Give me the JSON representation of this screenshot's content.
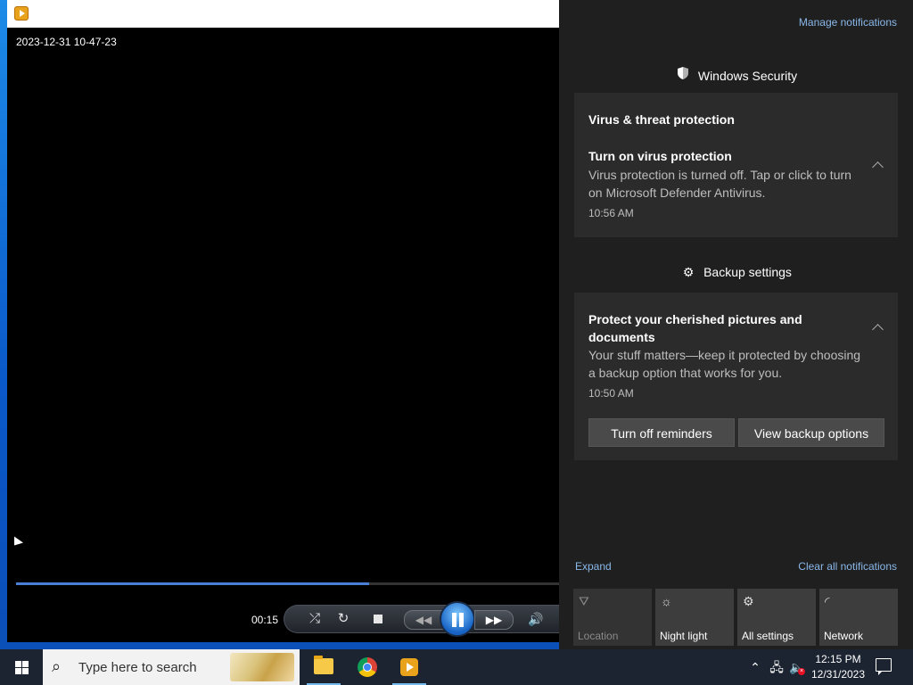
{
  "player": {
    "video_timestamp": "2023-12-31 10-47-23",
    "elapsed": "00:15",
    "progress_fraction": 0.65,
    "controls": {
      "shuffle_icon": "shuffle-icon",
      "repeat_icon": "repeat-icon",
      "stop_icon": "stop-icon",
      "prev_icon": "previous-icon",
      "play_state": "pause-icon",
      "next_icon": "next-icon",
      "volume_icon": "volume-icon"
    }
  },
  "action_center": {
    "manage_label": "Manage notifications",
    "groups": [
      {
        "app": "Windows Security",
        "icon": "shield-icon",
        "card": {
          "title": "Virus & threat protection",
          "heading": "Turn on virus protection",
          "body": "Virus protection is turned off. Tap or click to turn on Microsoft Defender Antivirus.",
          "time": "10:56 AM"
        }
      },
      {
        "app": "Backup settings",
        "icon": "gear-icon",
        "card": {
          "heading": "Protect your cherished pictures and documents",
          "body": "Your stuff matters—keep it protected by choosing a backup option that works for you.",
          "time": "10:50 AM",
          "buttons": [
            "Turn off reminders",
            "View backup options"
          ]
        }
      }
    ],
    "expand_label": "Expand",
    "clear_label": "Clear all notifications",
    "quick_actions": [
      {
        "label": "Location",
        "icon": "location-icon",
        "enabled": false
      },
      {
        "label": "Night light",
        "icon": "night-light-icon",
        "enabled": true
      },
      {
        "label": "All settings",
        "icon": "gear-icon",
        "enabled": true
      },
      {
        "label": "Network",
        "icon": "network-icon",
        "enabled": true
      }
    ]
  },
  "taskbar": {
    "search_placeholder": "Type here to search",
    "apps": [
      {
        "name": "File Explorer",
        "icon": "folder-icon"
      },
      {
        "name": "Google Chrome",
        "icon": "chrome-icon"
      },
      {
        "name": "Media Player",
        "icon": "media-player-icon"
      }
    ],
    "clock_time": "12:15 PM",
    "clock_date": "12/31/2023"
  },
  "colors": {
    "accent": "#0078d7",
    "link": "#8ab8ea",
    "action_center_bg": "#1f1f1f",
    "card_bg": "#2b2b2b",
    "taskbar_bg": "#1c2331"
  }
}
